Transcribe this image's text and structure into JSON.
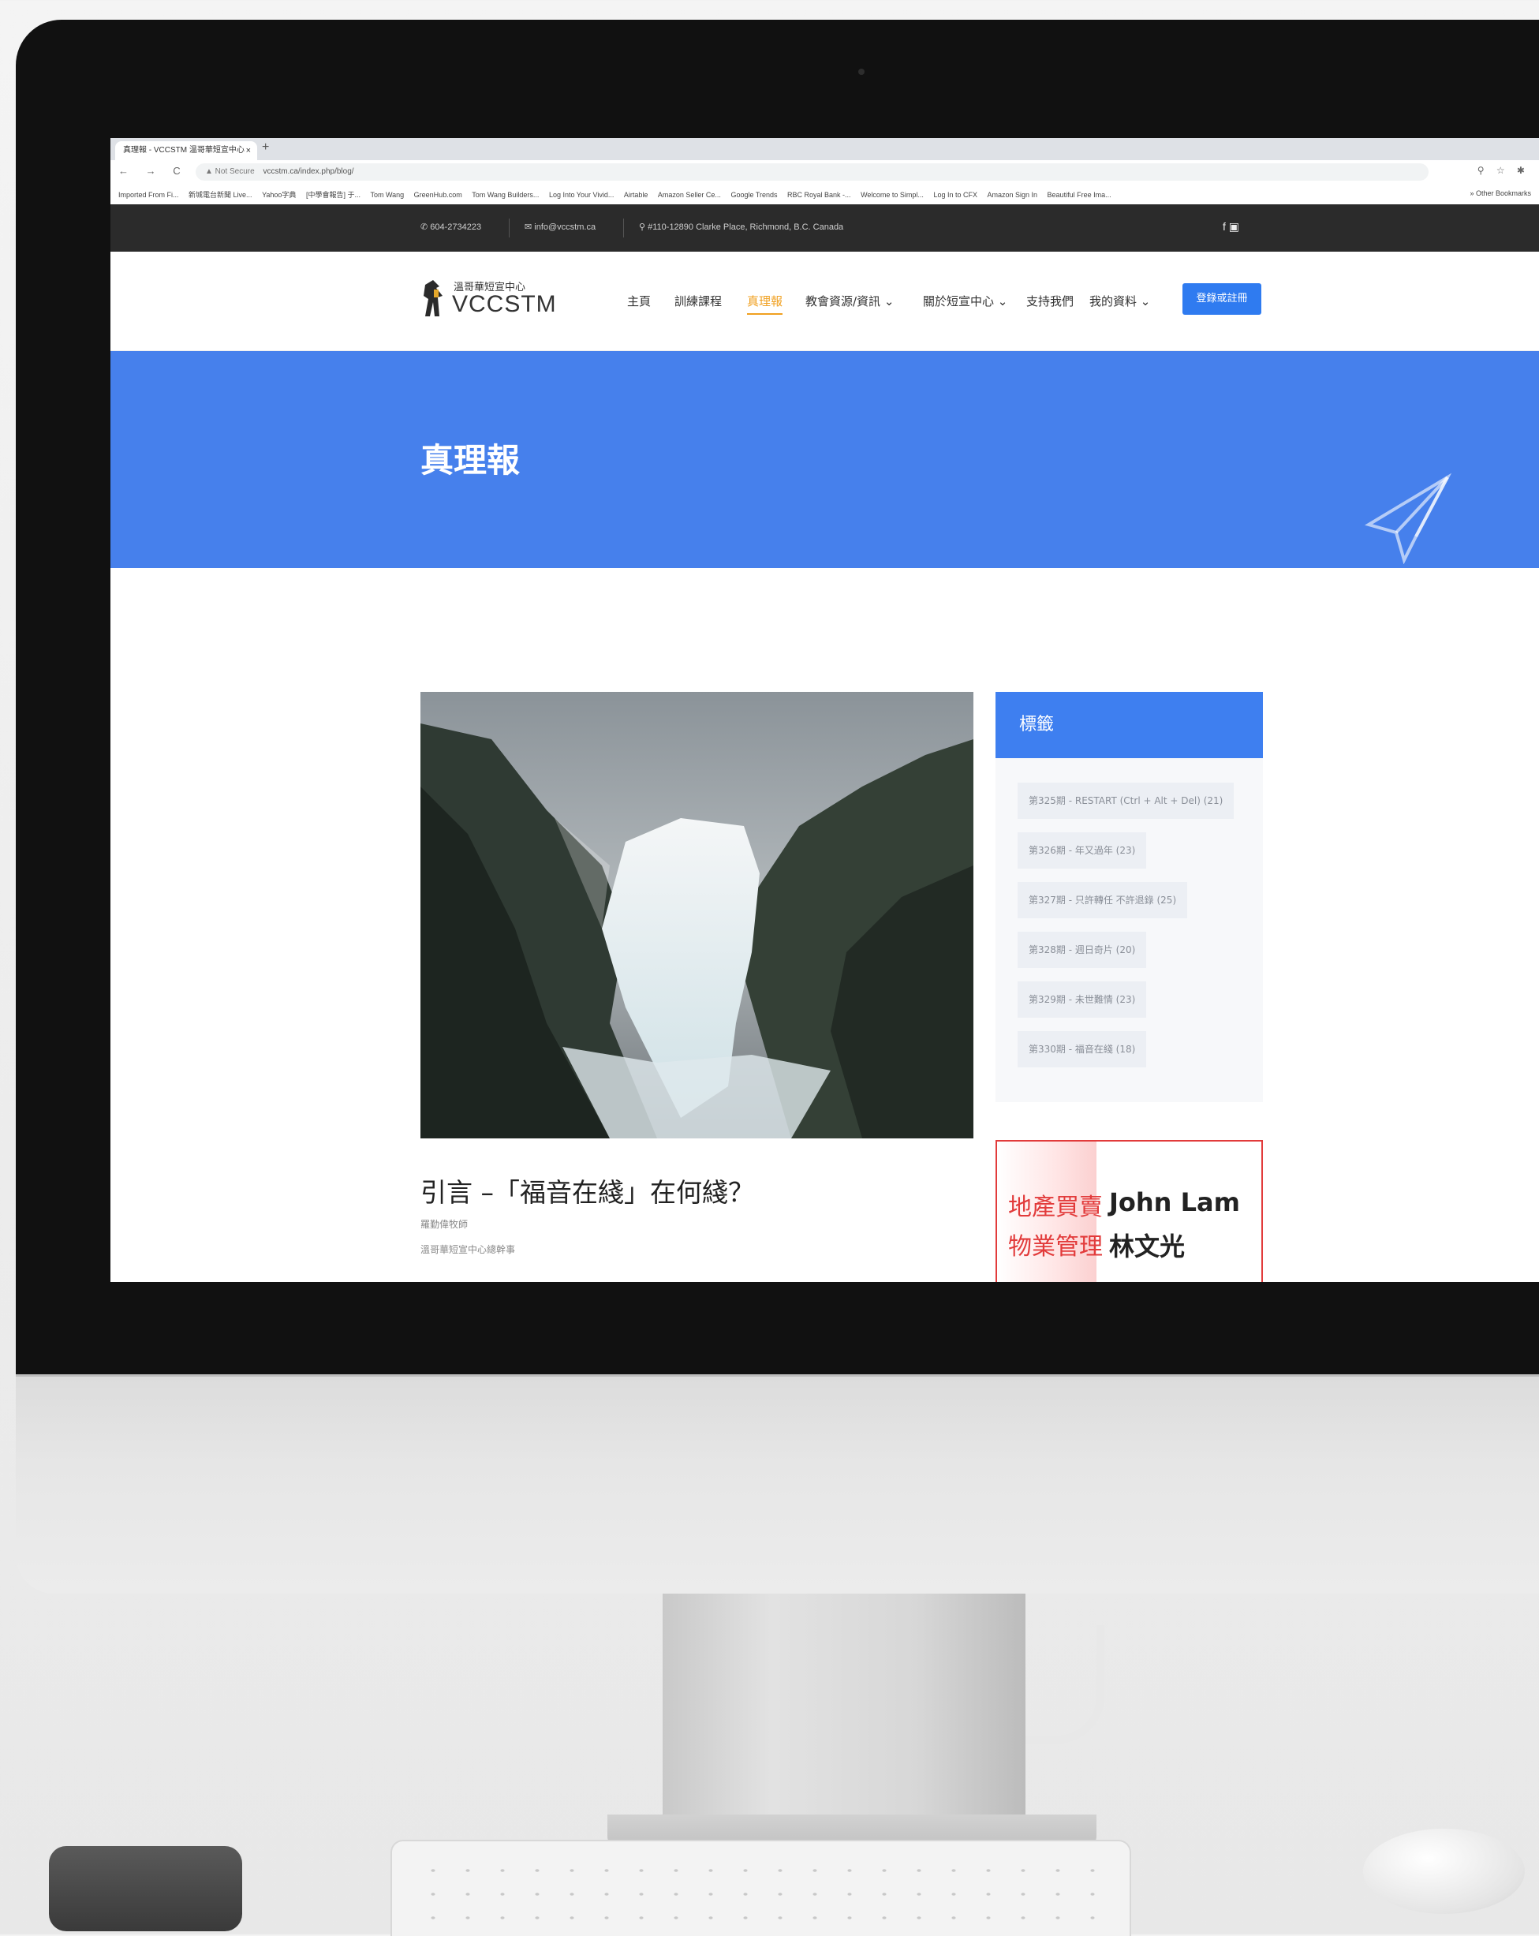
{
  "browser": {
    "tab_title": "真理報 - VCCSTM 温哥華短宣中心",
    "tab_close": "×",
    "new_tab": "+",
    "nav_icons": "← → C ⌂",
    "security": "▲ Not Secure",
    "url": "vccstm.ca/index.php/blog/",
    "right_icons": "⚲ ☆ ✱",
    "bookmarks": [
      "Imported From Fi...",
      "新城電台新聞 Live...",
      "Yahoo字典",
      "[中學會報告] 于...",
      "Tom Wang",
      "GreenHub.com",
      "Tom Wang Builders...",
      "Log Into Your Vivid...",
      "Airtable",
      "Amazon Seller Ce...",
      "Google Trends",
      "RBC Royal Bank -...",
      "Welcome to Simpl...",
      "Log In to CFX",
      "Amazon Sign In",
      "Beautiful Free Ima..."
    ],
    "bookmarks_right": "» Other Bookmarks"
  },
  "infobar": {
    "phone": "604-2734223",
    "email": "info@vccstm.ca",
    "address": "#110-12890 Clarke Place, Richmond, B.C. Canada",
    "social": "f ▣"
  },
  "header": {
    "logo_cn": "溫哥華短宣中心",
    "logo_en": "VCCSTM",
    "menu": [
      "主頁",
      "訓練課程",
      "真理報",
      "教會資源/資訊 ⌄",
      "關於短宣中心 ⌄",
      "支持我們",
      "我的資料 ⌄"
    ],
    "register": "登錄或註冊"
  },
  "hero": {
    "title": "真理報"
  },
  "article": {
    "title": "引言 –「福音在綫」在何綫？",
    "meta1": "羅勤偉牧師",
    "meta2": "溫哥華短宣中心總幹事"
  },
  "tags": {
    "heading": "標籤",
    "items": [
      "第325期 - RESTART (Ctrl + Alt + Del) (21)",
      "第326期 - 年又過年 (23)",
      "第327期 - 只許轉任 不許退錄 (25)",
      "第328期 - 週日奇片 (20)",
      "第329期 - 未世難情 (23)",
      "第330期 - 福音在綫 (18)"
    ]
  },
  "ad": {
    "line1_left": "地產買賣",
    "line2_left": "物業管理",
    "line1_right": "John Lam",
    "line2_right": "林文光"
  },
  "colors": {
    "accent_blue": "#2f7bf0",
    "hero_blue": "#4680ec",
    "active_menu": "#f0a020",
    "ad_red": "#e23b3b"
  }
}
